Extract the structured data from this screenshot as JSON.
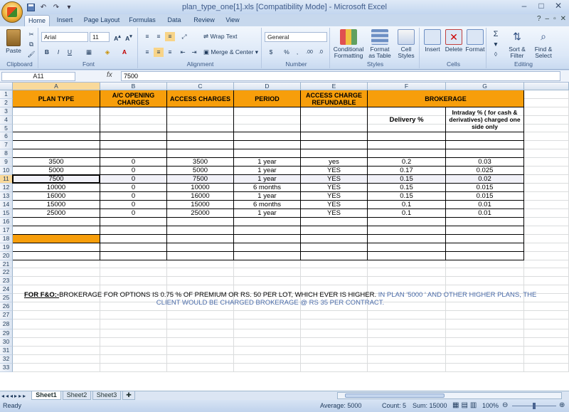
{
  "window": {
    "title": "plan_type_one[1].xls  [Compatibility Mode] - Microsoft Excel"
  },
  "tabs": [
    "Home",
    "Insert",
    "Page Layout",
    "Formulas",
    "Data",
    "Review",
    "View"
  ],
  "ribbon": {
    "clipboard": {
      "label": "Clipboard",
      "paste": "Paste"
    },
    "font": {
      "label": "Font",
      "name": "Arial",
      "size": "11"
    },
    "alignment": {
      "label": "Alignment",
      "wrap": "Wrap Text",
      "merge": "Merge & Center"
    },
    "number": {
      "label": "Number",
      "format": "General",
      "currency": "$",
      "percent": "%",
      "comma": ","
    },
    "styles": {
      "label": "Styles",
      "conditional": "Conditional Formatting",
      "table": "Format as Table",
      "cell": "Cell Styles"
    },
    "cells": {
      "label": "Cells",
      "insert": "Insert",
      "delete": "Delete",
      "format": "Format"
    },
    "editing": {
      "label": "Editing",
      "sort": "Sort & Filter",
      "find": "Find & Select"
    }
  },
  "formula_bar": {
    "name_box": "A11",
    "fx": "fx",
    "value": "7500"
  },
  "columns": [
    "A",
    "B",
    "C",
    "D",
    "E",
    "F",
    "G"
  ],
  "header": {
    "plan": "PLAN TYPE",
    "ac": "A/C OPENING CHARGES",
    "access": "ACCESS CHARGES",
    "period": "PERIOD",
    "refund": "ACCESS CHARGE REFUNDABLE",
    "brokerage": "BROKERAGE",
    "delivery": "Delivery %",
    "intraday": "Intraday % ( for cash & derivatives) charged one side only"
  },
  "rows": [
    [
      "3500",
      "0",
      "3500",
      "1 year",
      "yes",
      "0.2",
      "0.03"
    ],
    [
      "5000",
      "0",
      "5000",
      "1 year",
      "YES",
      "0.17",
      "0.025"
    ],
    [
      "7500",
      "0",
      "7500",
      "1 year",
      "YES",
      "0.15",
      "0.02"
    ],
    [
      "10000",
      "0",
      "10000",
      "6 months",
      "YES",
      "0.15",
      "0.015"
    ],
    [
      "16000",
      "0",
      "16000",
      "1 year",
      "YES",
      "0.15",
      "0.015"
    ],
    [
      "15000",
      "0",
      "15000",
      "6 months",
      "YES",
      "0.1",
      "0.01"
    ],
    [
      "25000",
      "0",
      "25000",
      "1 year",
      "YES",
      "0.1",
      "0.01"
    ]
  ],
  "note": {
    "lead": "FOR F&O:-",
    "text1": "BROKERAGE FOR OPTIONS IS 0.75 % OF PREMIUM OR RS. 50 PER LOT, WHICH EVER IS HIGHER.",
    "text2": " IN PLAN '5000 ' AND OTHER HIGHER PLANS, THE",
    "text3": "CLIENT WOULD BE CHARGED BROKERAGE @ RS 35 PER CONTRACT."
  },
  "sheets": [
    "Sheet1",
    "Sheet2",
    "Sheet3"
  ],
  "status": {
    "ready": "Ready",
    "average": "Average: 5000",
    "count": "Count: 5",
    "sum": "Sum: 15000",
    "zoom": "100%"
  },
  "colors": {
    "header_orange": "#f79e0b",
    "note_blue": "#4a6ba8"
  }
}
